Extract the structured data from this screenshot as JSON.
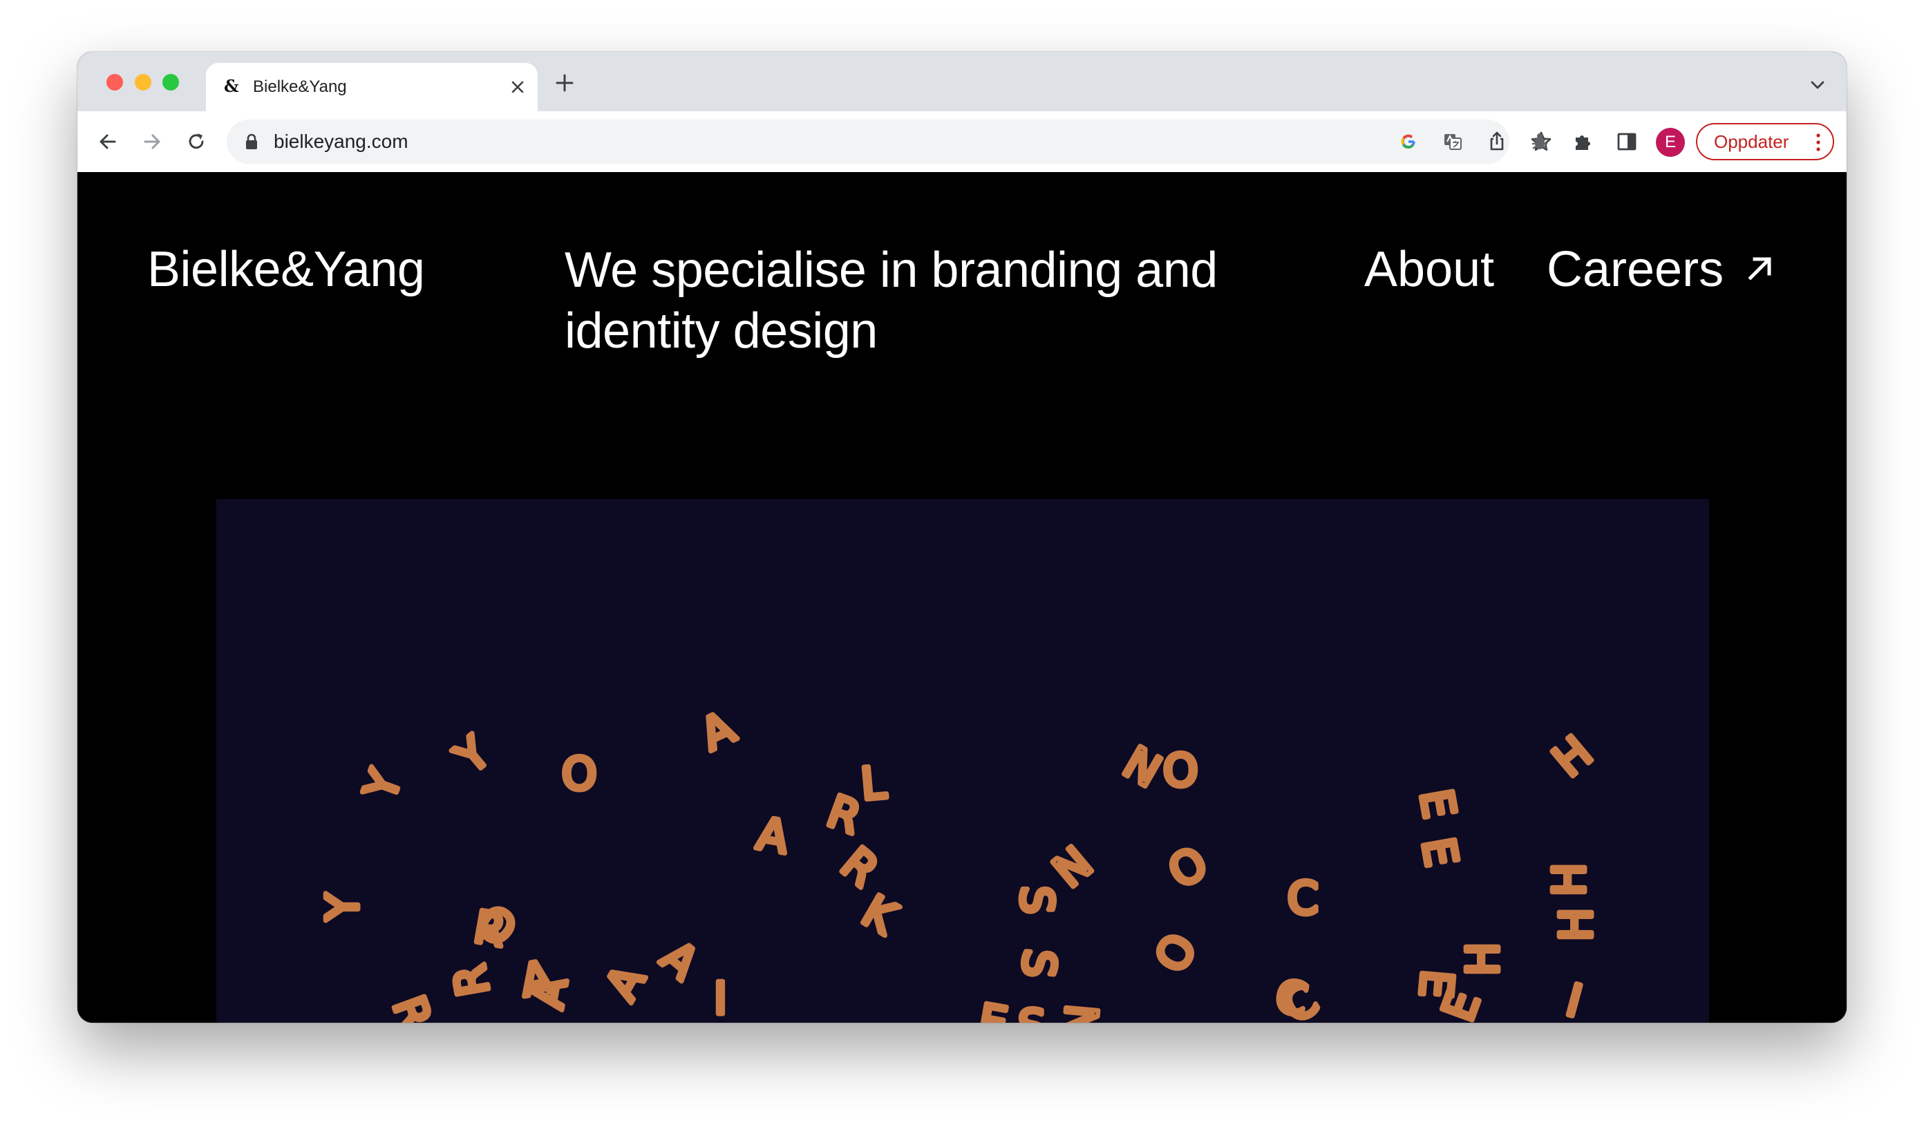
{
  "browser": {
    "tab": {
      "favicon": "&",
      "title": "Bielke&Yang"
    },
    "address_bar": {
      "url": "bielkeyang.com"
    },
    "profile": {
      "initial": "E"
    },
    "update_button": {
      "label": "Oppdater"
    },
    "colors": {
      "accent": "#c5221f",
      "avatar": "#c2185b",
      "chrome": "#dee1e6"
    }
  },
  "site": {
    "logo": "Bielke&Yang",
    "tagline": "We specialise in branding and identity design",
    "nav": {
      "about": "About",
      "careers": "Careers"
    },
    "hero": {
      "background": "#0d0a24",
      "letter_color": "#c87a45",
      "letters": [
        "Y",
        "Y",
        "O",
        "A",
        "R",
        "A",
        "L",
        "R",
        "S",
        "S",
        "N",
        "O",
        "O",
        "C",
        "C",
        "E",
        "E",
        "H",
        "H",
        "H",
        "Y",
        "R",
        "O",
        "R",
        "A",
        "A",
        "K",
        "N",
        "O",
        "C",
        "E",
        "H",
        "I",
        "R",
        "A",
        "E",
        "N",
        "E",
        "S",
        "A",
        "I"
      ]
    }
  }
}
